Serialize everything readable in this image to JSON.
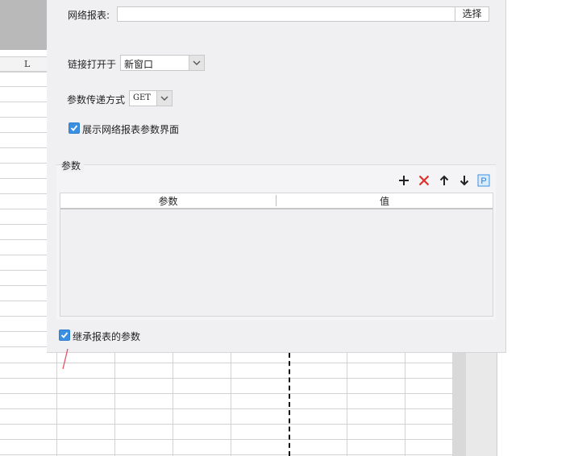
{
  "sheet": {
    "column_header": "L"
  },
  "dialog": {
    "network_report_label": "网络报表:",
    "network_report_value": "",
    "choose_button": "选择",
    "open_link_label": "链接打开于",
    "open_link_value": "新窗口",
    "param_method_label": "参数传递方式",
    "param_method_value": "GET",
    "show_params_label": "展示网络报表参数界面",
    "show_params_checked": true,
    "params_group_title": "参数",
    "toolbar": [
      "add-icon",
      "delete-icon",
      "move-up-icon",
      "move-down-icon",
      "parameter-p-icon"
    ],
    "table_headers": [
      "参数",
      "值"
    ],
    "table_rows": [],
    "inherit_params_label": "继承报表的参数",
    "inherit_params_checked": true
  },
  "colors": {
    "accent_blue": "#3b8fe0",
    "delete_red": "#e0302a",
    "dialog_bg": "#f0f0f3"
  }
}
